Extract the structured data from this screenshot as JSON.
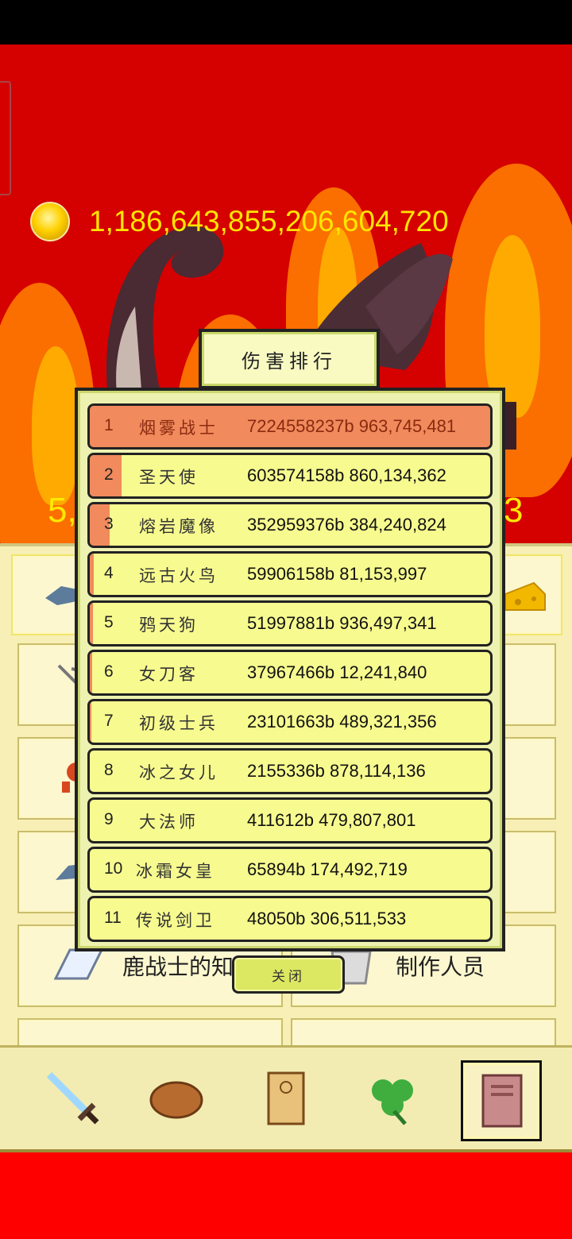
{
  "currency": {
    "coins": "1,186,643,855,206,604,720",
    "icon": "coin-icon"
  },
  "edge_numbers": {
    "left": "5,",
    "right": "3"
  },
  "background_menu": {
    "book_label": "鹿战士的知识",
    "credits_label": "制作人员"
  },
  "modal": {
    "title": "伤害排行",
    "close_label": "关闭",
    "rows": [
      {
        "rank": "1",
        "name": "烟雾战士",
        "score": "7224558237b 963,745,481",
        "share": 1.0
      },
      {
        "rank": "2",
        "name": "圣天使",
        "score": "603574158b 860,134,362",
        "share": 0.08
      },
      {
        "rank": "3",
        "name": "熔岩魔像",
        "score": "352959376b 384,240,824",
        "share": 0.05
      },
      {
        "rank": "4",
        "name": "远古火鸟",
        "score": "59906158b 81,153,997",
        "share": 0.01
      },
      {
        "rank": "5",
        "name": "鸦天狗",
        "score": "51997881b 936,497,341",
        "share": 0.007
      },
      {
        "rank": "6",
        "name": "女刀客",
        "score": "37967466b 12,241,840",
        "share": 0.005
      },
      {
        "rank": "7",
        "name": "初级士兵",
        "score": "23101663b 489,321,356",
        "share": 0.003
      },
      {
        "rank": "8",
        "name": "冰之女儿",
        "score": "2155336b 878,114,136",
        "share": 0.0
      },
      {
        "rank": "9",
        "name": "大法师",
        "score": "411612b 479,807,801",
        "share": 0.0
      },
      {
        "rank": "10",
        "name": "冰霜女皇",
        "score": "65894b 174,492,719",
        "share": 0.0
      },
      {
        "rank": "11",
        "name": "传说剑卫",
        "score": "48050b 306,511,533",
        "share": 0.0
      }
    ]
  },
  "bottom_nav": [
    {
      "icon": "sword-icon",
      "active": false
    },
    {
      "icon": "bread-icon",
      "active": false
    },
    {
      "icon": "scroll-icon",
      "active": false
    },
    {
      "icon": "clover-icon",
      "active": false
    },
    {
      "icon": "book-icon",
      "active": true
    }
  ],
  "colors": {
    "sky": "#d50000",
    "coin_text": "#ffe600",
    "row_fill": "#f7fb8f",
    "damage_bar": "#f18a5c"
  }
}
